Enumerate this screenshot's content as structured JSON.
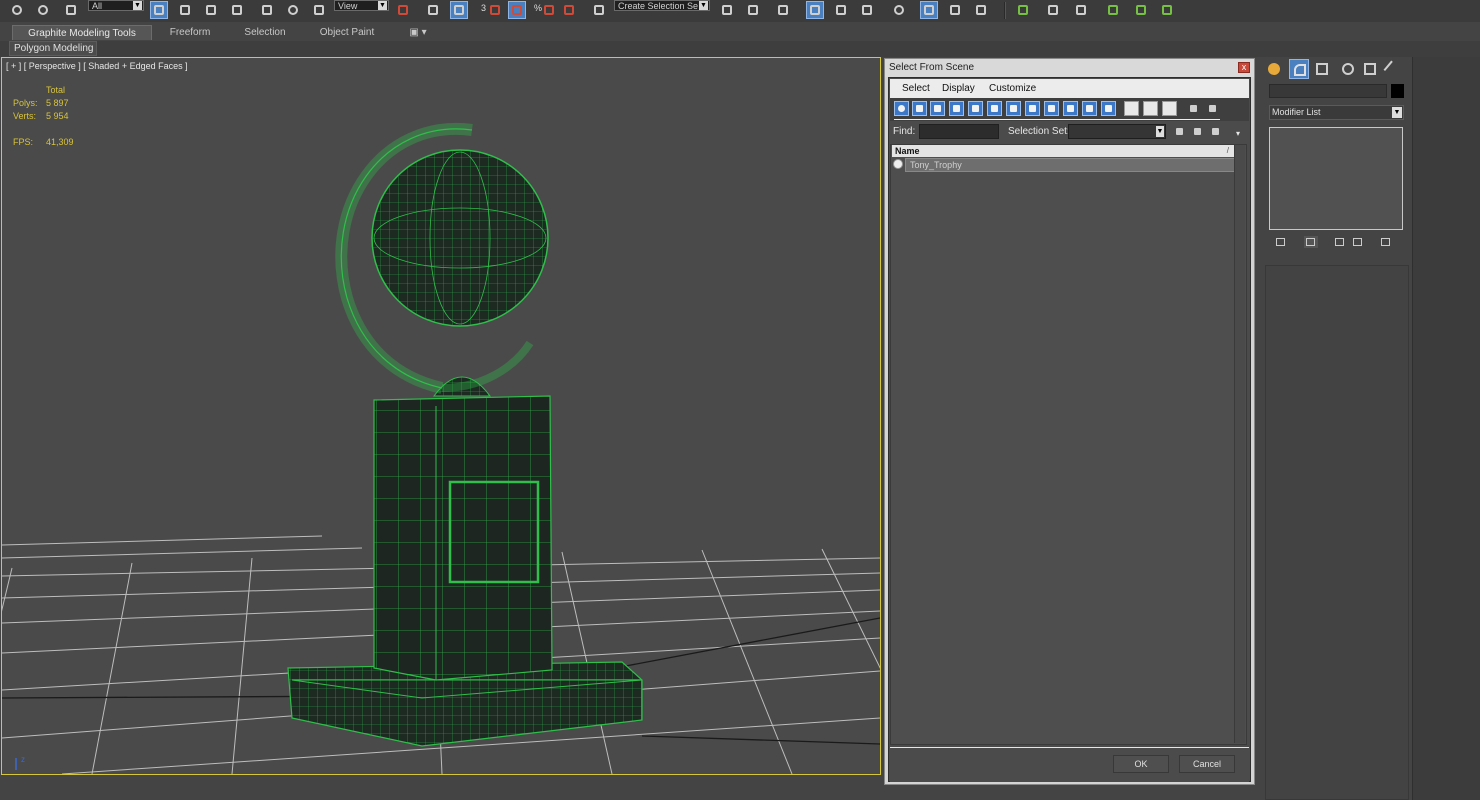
{
  "toolbar": {
    "selection_filter": "All",
    "ref_coord": "View",
    "named_selection": "Create Selection Se",
    "snap_label": "3",
    "percent_label": "%"
  },
  "ribbon": {
    "tabs": [
      "Graphite Modeling Tools",
      "Freeform",
      "Selection",
      "Object Paint"
    ],
    "panel_button": "Polygon Modeling"
  },
  "viewport": {
    "label": "[ + ] [ Perspective ] [ Shaded + Edged Faces ]",
    "stats": {
      "total_header": "Total",
      "polys_label": "Polys:",
      "polys_value": "5 897",
      "verts_label": "Verts:",
      "verts_value": "5 954",
      "fps_label": "FPS:",
      "fps_value": "41,309"
    },
    "axis_label": "z"
  },
  "dialog": {
    "title": "Select From Scene",
    "close_glyph": "x",
    "menu": [
      "Select",
      "Display",
      "Customize"
    ],
    "find_label": "Find:",
    "find_value": "",
    "selection_set_label": "Selection Set:",
    "selection_set_value": "",
    "column_header": "Name",
    "sort_glyph": "/",
    "rows": [
      "Tony_Trophy"
    ],
    "ok_label": "OK",
    "cancel_label": "Cancel"
  },
  "command_panel": {
    "modifier_list": "Modifier List",
    "object_name": ""
  },
  "colors": {
    "viewport_border": "#d6c63a",
    "stat_text": "#d8c33a",
    "wireframe": "#2fbf4a",
    "active_blue": "#4a7fc0"
  }
}
